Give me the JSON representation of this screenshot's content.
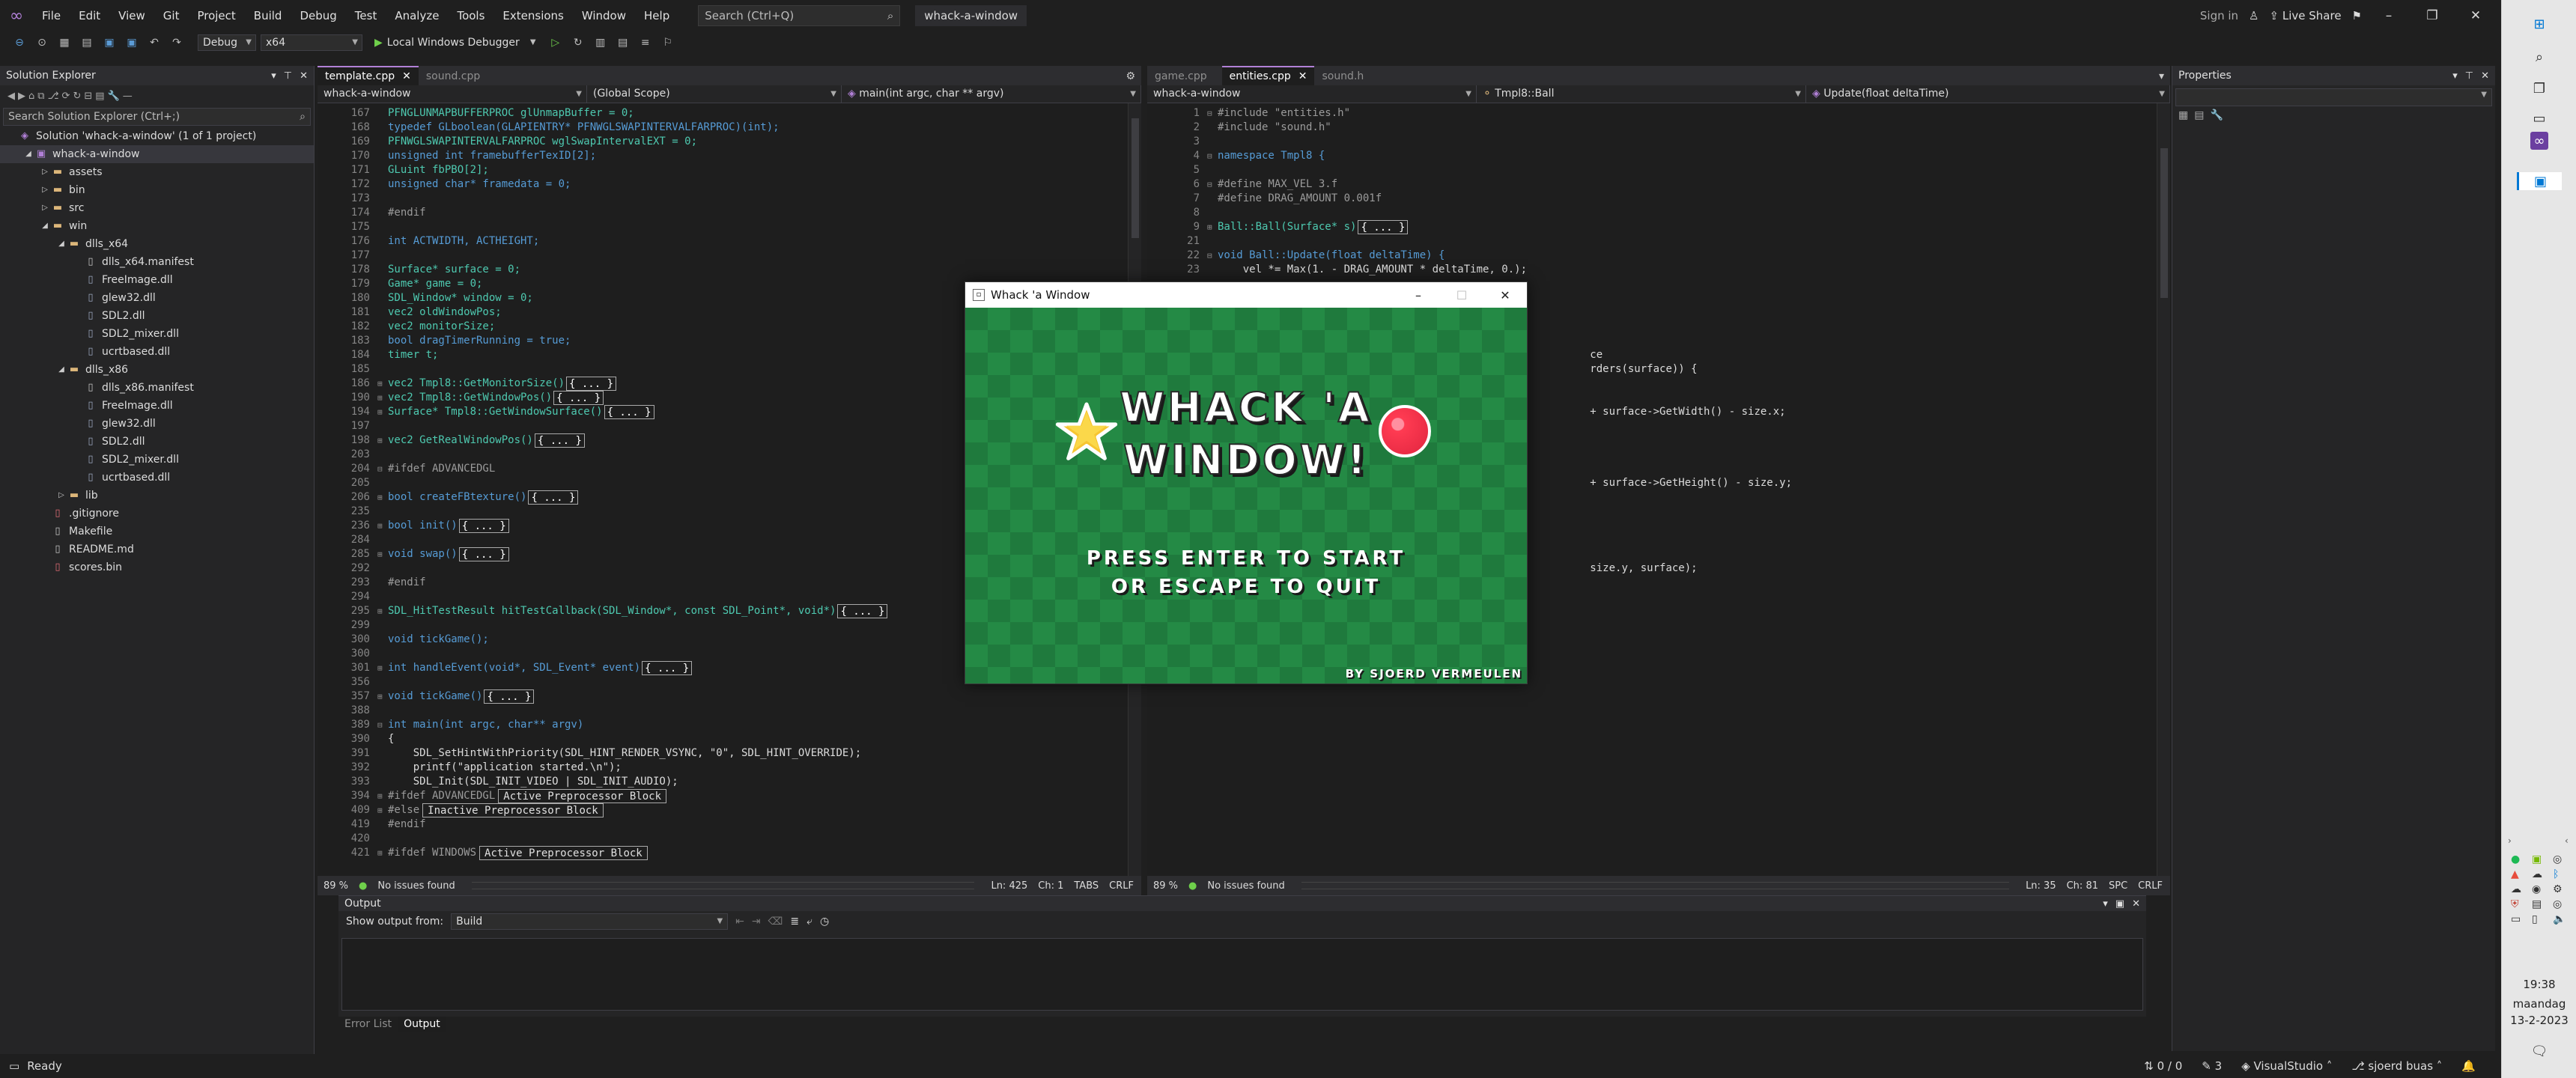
{
  "menubar": {
    "items": [
      "File",
      "Edit",
      "View",
      "Git",
      "Project",
      "Build",
      "Debug",
      "Test",
      "Analyze",
      "Tools",
      "Extensions",
      "Window",
      "Help"
    ],
    "search_placeholder": "Search (Ctrl+Q)",
    "solution_name": "whack-a-window",
    "sign_in": "Sign in",
    "live_share": "Live Share"
  },
  "toolbar": {
    "config": "Debug",
    "platform": "x64",
    "run_label": "Local Windows Debugger"
  },
  "solution_explorer": {
    "title": "Solution Explorer",
    "search_placeholder": "Search Solution Explorer (Ctrl+;)",
    "tree": [
      {
        "label": "Solution 'whack-a-window' (1 of 1 project)",
        "kind": "sol",
        "depth": 0,
        "arrow": ""
      },
      {
        "label": "whack-a-window",
        "kind": "proj",
        "depth": 1,
        "arrow": "◢",
        "selected": true
      },
      {
        "label": "assets",
        "kind": "folder",
        "depth": 2,
        "arrow": "▷"
      },
      {
        "label": "bin",
        "kind": "folder",
        "depth": 2,
        "arrow": "▷"
      },
      {
        "label": "src",
        "kind": "folder",
        "depth": 2,
        "arrow": "▷"
      },
      {
        "label": "win",
        "kind": "folder",
        "depth": 2,
        "arrow": "◢"
      },
      {
        "label": "dlls_x64",
        "kind": "folder",
        "depth": 3,
        "arrow": "◢"
      },
      {
        "label": "dlls_x64.manifest",
        "kind": "file",
        "depth": 4,
        "arrow": ""
      },
      {
        "label": "FreeImage.dll",
        "kind": "dll",
        "depth": 4,
        "arrow": ""
      },
      {
        "label": "glew32.dll",
        "kind": "dll",
        "depth": 4,
        "arrow": ""
      },
      {
        "label": "SDL2.dll",
        "kind": "dll",
        "depth": 4,
        "arrow": ""
      },
      {
        "label": "SDL2_mixer.dll",
        "kind": "dll",
        "depth": 4,
        "arrow": ""
      },
      {
        "label": "ucrtbased.dll",
        "kind": "dll",
        "depth": 4,
        "arrow": ""
      },
      {
        "label": "dlls_x86",
        "kind": "folder",
        "depth": 3,
        "arrow": "◢"
      },
      {
        "label": "dlls_x86.manifest",
        "kind": "file",
        "depth": 4,
        "arrow": ""
      },
      {
        "label": "FreeImage.dll",
        "kind": "dll",
        "depth": 4,
        "arrow": ""
      },
      {
        "label": "glew32.dll",
        "kind": "dll",
        "depth": 4,
        "arrow": ""
      },
      {
        "label": "SDL2.dll",
        "kind": "dll",
        "depth": 4,
        "arrow": ""
      },
      {
        "label": "SDL2_mixer.dll",
        "kind": "dll",
        "depth": 4,
        "arrow": ""
      },
      {
        "label": "ucrtbased.dll",
        "kind": "dll",
        "depth": 4,
        "arrow": ""
      },
      {
        "label": "lib",
        "kind": "folder",
        "depth": 3,
        "arrow": "▷"
      },
      {
        "label": ".gitignore",
        "kind": "git",
        "depth": 2,
        "arrow": ""
      },
      {
        "label": "Makefile",
        "kind": "file",
        "depth": 2,
        "arrow": ""
      },
      {
        "label": "README.md",
        "kind": "file",
        "depth": 2,
        "arrow": ""
      },
      {
        "label": "scores.bin",
        "kind": "git",
        "depth": 2,
        "arrow": ""
      }
    ]
  },
  "left_editor": {
    "tabs": [
      {
        "label": "template.cpp",
        "active": true
      },
      {
        "label": "sound.cpp",
        "active": false
      }
    ],
    "nav": [
      "whack-a-window",
      "(Global Scope)",
      "main(int argc, char ** argv)"
    ],
    "lines": [
      {
        "n": "167",
        "code": "PFNGLUNMAPBUFFERPROC glUnmapBuffer = 0;"
      },
      {
        "n": "168",
        "code": "typedef GLboolean(GLAPIENTRY* PFNWGLSWAPINTERVALFARPROC)(int);"
      },
      {
        "n": "169",
        "code": "PFNWGLSWAPINTERVALFARPROC wglSwapIntervalEXT = 0;"
      },
      {
        "n": "170",
        "code": "unsigned int framebufferTexID[2];"
      },
      {
        "n": "171",
        "code": "GLuint fbPBO[2];"
      },
      {
        "n": "172",
        "code": "unsigned char* framedata = 0;"
      },
      {
        "n": "173",
        "code": ""
      },
      {
        "n": "174",
        "code": "#endif"
      },
      {
        "n": "175",
        "code": ""
      },
      {
        "n": "176",
        "code": "int ACTWIDTH, ACTHEIGHT;"
      },
      {
        "n": "177",
        "code": ""
      },
      {
        "n": "178",
        "code": "Surface* surface = 0;"
      },
      {
        "n": "179",
        "code": "Game* game = 0;"
      },
      {
        "n": "180",
        "code": "SDL_Window* window = 0;"
      },
      {
        "n": "181",
        "code": "vec2 oldWindowPos;"
      },
      {
        "n": "182",
        "code": "vec2 monitorSize;"
      },
      {
        "n": "183",
        "code": "bool dragTimerRunning = true;"
      },
      {
        "n": "184",
        "code": "timer t;"
      },
      {
        "n": "185",
        "code": ""
      },
      {
        "n": "186",
        "code": "vec2 Tmpl8::GetMonitorSize()",
        "box": "{ ... }",
        "fold": "⊞"
      },
      {
        "n": "190",
        "code": "vec2 Tmpl8::GetWindowPos()",
        "box": "{ ... }",
        "fold": "⊞"
      },
      {
        "n": "194",
        "code": "Surface* Tmpl8::GetWindowSurface()",
        "box": "{ ... }",
        "fold": "⊞"
      },
      {
        "n": "197",
        "code": ""
      },
      {
        "n": "198",
        "code": "vec2 GetRealWindowPos()",
        "box": "{ ... }",
        "fold": "⊞"
      },
      {
        "n": "203",
        "code": ""
      },
      {
        "n": "204",
        "code": "#ifdef ADVANCEDGL",
        "fold": "⊟"
      },
      {
        "n": "205",
        "code": ""
      },
      {
        "n": "206",
        "code": "bool createFBtexture()",
        "box": "{ ... }",
        "fold": "⊞"
      },
      {
        "n": "235",
        "code": ""
      },
      {
        "n": "236",
        "code": "bool init()",
        "box": "{ ... }",
        "fold": "⊞"
      },
      {
        "n": "284",
        "code": ""
      },
      {
        "n": "285",
        "code": "void swap()",
        "box": "{ ... }",
        "fold": "⊞"
      },
      {
        "n": "292",
        "code": ""
      },
      {
        "n": "293",
        "code": "#endif"
      },
      {
        "n": "294",
        "code": ""
      },
      {
        "n": "295",
        "code": "SDL_HitTestResult hitTestCallback(SDL_Window*, const SDL_Point*, void*)",
        "box": "{ ... }",
        "fold": "⊞"
      },
      {
        "n": "299",
        "code": ""
      },
      {
        "n": "300",
        "code": "void tickGame();"
      },
      {
        "n": "300",
        "code": ""
      },
      {
        "n": "301",
        "code": "int handleEvent(void*, SDL_Event* event)",
        "box": "{ ... }",
        "fold": "⊞"
      },
      {
        "n": "356",
        "code": ""
      },
      {
        "n": "357",
        "code": "void tickGame()",
        "box": "{ ... }",
        "fold": "⊞"
      },
      {
        "n": "388",
        "code": ""
      },
      {
        "n": "389",
        "code": "int main(int argc, char** argv)",
        "fold": "⊟"
      },
      {
        "n": "390",
        "code": "{"
      },
      {
        "n": "391",
        "code": "    SDL_SetHintWithPriority(SDL_HINT_RENDER_VSYNC, \"0\", SDL_HINT_OVERRIDE);"
      },
      {
        "n": "392",
        "code": "    printf(\"application started.\\n\");"
      },
      {
        "n": "393",
        "code": "    SDL_Init(SDL_INIT_VIDEO | SDL_INIT_AUDIO);"
      },
      {
        "n": "394",
        "code": "#ifdef ADVANCEDGL",
        "tag": "Active Preprocessor Block",
        "fold": "⊞"
      },
      {
        "n": "409",
        "code": "#else",
        "tag": "Inactive Preprocessor Block",
        "fold": "⊞"
      },
      {
        "n": "419",
        "code": "#endif"
      },
      {
        "n": "420",
        "code": ""
      },
      {
        "n": "421",
        "code": "#ifdef WINDOWS",
        "tag": "Active Preprocessor Block",
        "fold": "⊞"
      }
    ],
    "zoom": "89 %",
    "issues": "No issues found",
    "ln": "Ln: 425",
    "ch": "Ch: 1",
    "ws": "TABS",
    "eol": "CRLF"
  },
  "right_editor": {
    "tabs": [
      {
        "label": "game.cpp",
        "active": false
      },
      {
        "label": "entities.cpp",
        "active": true
      },
      {
        "label": "sound.h",
        "active": false
      }
    ],
    "nav": [
      "whack-a-window",
      "Tmpl8::Ball",
      "Update(float deltaTime)"
    ],
    "lines": [
      {
        "n": "1",
        "code": "#include \"entities.h\"",
        "fold": "⊟"
      },
      {
        "n": "2",
        "code": "#include \"sound.h\""
      },
      {
        "n": "3",
        "code": ""
      },
      {
        "n": "4",
        "code": "namespace Tmpl8 {",
        "fold": "⊟"
      },
      {
        "n": "5",
        "code": ""
      },
      {
        "n": "6",
        "code": "#define MAX_VEL 3.f",
        "fold": "⊟"
      },
      {
        "n": "7",
        "code": "#define DRAG_AMOUNT 0.001f"
      },
      {
        "n": "8",
        "code": ""
      },
      {
        "n": "9",
        "code": "Ball::Ball(Surface* s)",
        "box": "{ ... }",
        "fold": "⊞"
      },
      {
        "n": "21",
        "code": ""
      },
      {
        "n": "22",
        "code": "void Ball::Update(float deltaTime) {",
        "fold": "⊟"
      },
      {
        "n": "23",
        "code": "    vel *= Max(1. - DRAG_AMOUNT * deltaTime, 0.);"
      },
      {
        "n": "",
        "code": ""
      },
      {
        "n": "",
        "code": ""
      },
      {
        "n": "",
        "code": ""
      },
      {
        "n": "",
        "code": ""
      },
      {
        "n": "",
        "code": ""
      },
      {
        "n": "",
        "code": "                                                           ce"
      },
      {
        "n": "",
        "code": "                                                           rders(surface)) {"
      },
      {
        "n": "",
        "code": ""
      },
      {
        "n": "",
        "code": ""
      },
      {
        "n": "",
        "code": "                                                           + surface->GetWidth() - size.x;"
      },
      {
        "n": "",
        "code": ""
      },
      {
        "n": "",
        "code": ""
      },
      {
        "n": "",
        "code": ""
      },
      {
        "n": "",
        "code": ""
      },
      {
        "n": "",
        "code": "                                                           + surface->GetHeight() - size.y;"
      },
      {
        "n": "",
        "code": ""
      },
      {
        "n": "",
        "code": ""
      },
      {
        "n": "",
        "code": ""
      },
      {
        "n": "",
        "code": ""
      },
      {
        "n": "",
        "code": ""
      },
      {
        "n": "",
        "code": "                                                           size.y, surface);"
      }
    ],
    "zoom": "89 %",
    "issues": "No issues found",
    "ln": "Ln: 35",
    "ch": "Ch: 81",
    "ws": "SPC",
    "eol": "CRLF"
  },
  "output": {
    "title": "Output",
    "show_from_label": "Show output from:",
    "show_from_value": "Build",
    "tabs": [
      "Error List",
      "Output"
    ]
  },
  "properties": {
    "title": "Properties"
  },
  "game_window": {
    "title": "Whack 'a Window",
    "heading_line1": "WHACK 'A",
    "heading_line2": "WINDOW!",
    "prompt_line1": "PRESS ENTER TO START",
    "prompt_line2": "OR ESCAPE TO QUIT",
    "credit": "BY SJOERD VERMEULEN"
  },
  "statusbar": {
    "ready": "Ready",
    "git_changes": "0 / 0",
    "pencil_count": "3",
    "repo": "VisualStudio",
    "branch": "sjoerd buas"
  },
  "taskbar": {
    "time": "19:38",
    "day": "maandag",
    "date": "13-2-2023"
  }
}
